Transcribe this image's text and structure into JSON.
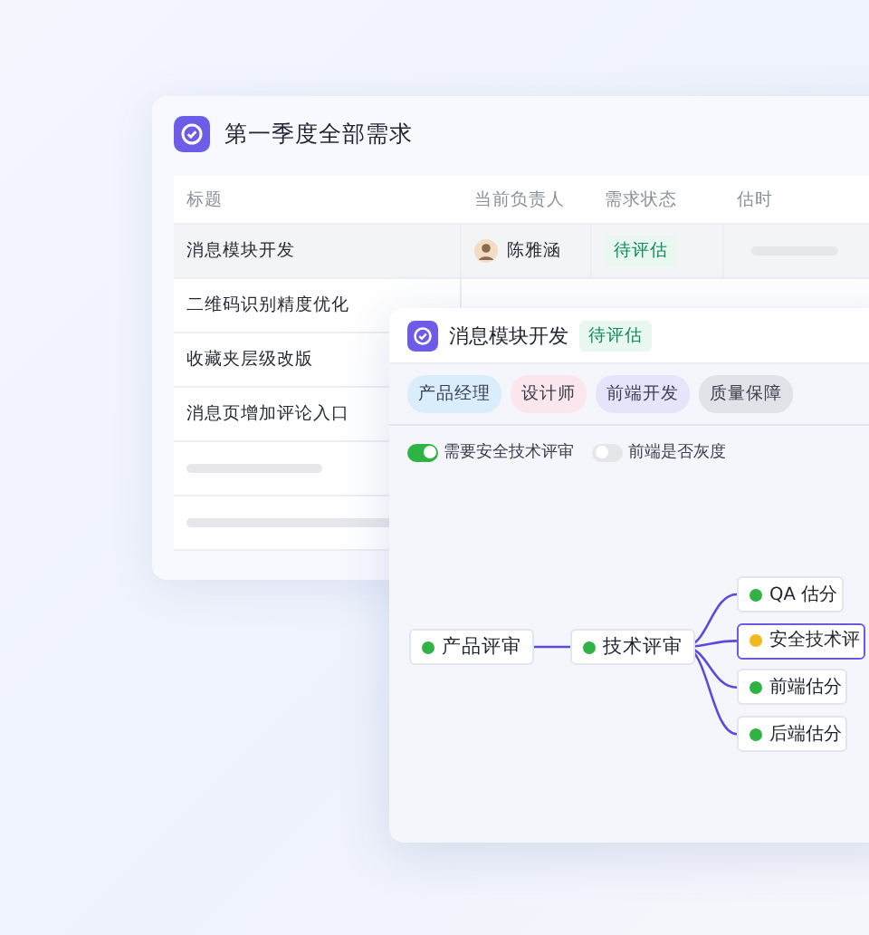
{
  "board": {
    "title": "第一季度全部需求",
    "columns": [
      "标题",
      "当前负责人",
      "需求状态",
      "估时"
    ],
    "rows": [
      {
        "title": "消息模块开发",
        "owner": "陈雅涵",
        "status": "待评估",
        "selected": true
      },
      {
        "title": "二维码识别精度优化",
        "selected": false
      },
      {
        "title": "收藏夹层级改版",
        "selected": false
      },
      {
        "title": "消息页增加评论入口",
        "selected": false
      }
    ]
  },
  "detail": {
    "title": "消息模块开发",
    "status": "待评估",
    "tags": [
      {
        "label": "产品经理",
        "color": "#d9eefa"
      },
      {
        "label": "设计师",
        "color": "#fbe6ee"
      },
      {
        "label": "前端开发",
        "color": "#e6e4fb"
      },
      {
        "label": "质量保障",
        "color": "#e2e3e8"
      }
    ],
    "toggles": [
      {
        "label": "需要安全技术评审",
        "on": true
      },
      {
        "label": "前端是否灰度",
        "on": false
      }
    ],
    "flow": {
      "label": "产品评审",
      "color": "#2fb344",
      "selected": false,
      "children": [
        {
          "label": "技术评审",
          "color": "#2fb344",
          "selected": false,
          "children": [
            {
              "label": "QA 估分",
              "color": "#2fb344",
              "selected": false
            },
            {
              "label": "安全技术评",
              "color": "#f2b91c",
              "selected": true
            },
            {
              "label": "前端估分",
              "color": "#2fb344",
              "selected": false
            },
            {
              "label": "后端估分",
              "color": "#2fb344",
              "selected": false
            }
          ]
        }
      ]
    }
  }
}
